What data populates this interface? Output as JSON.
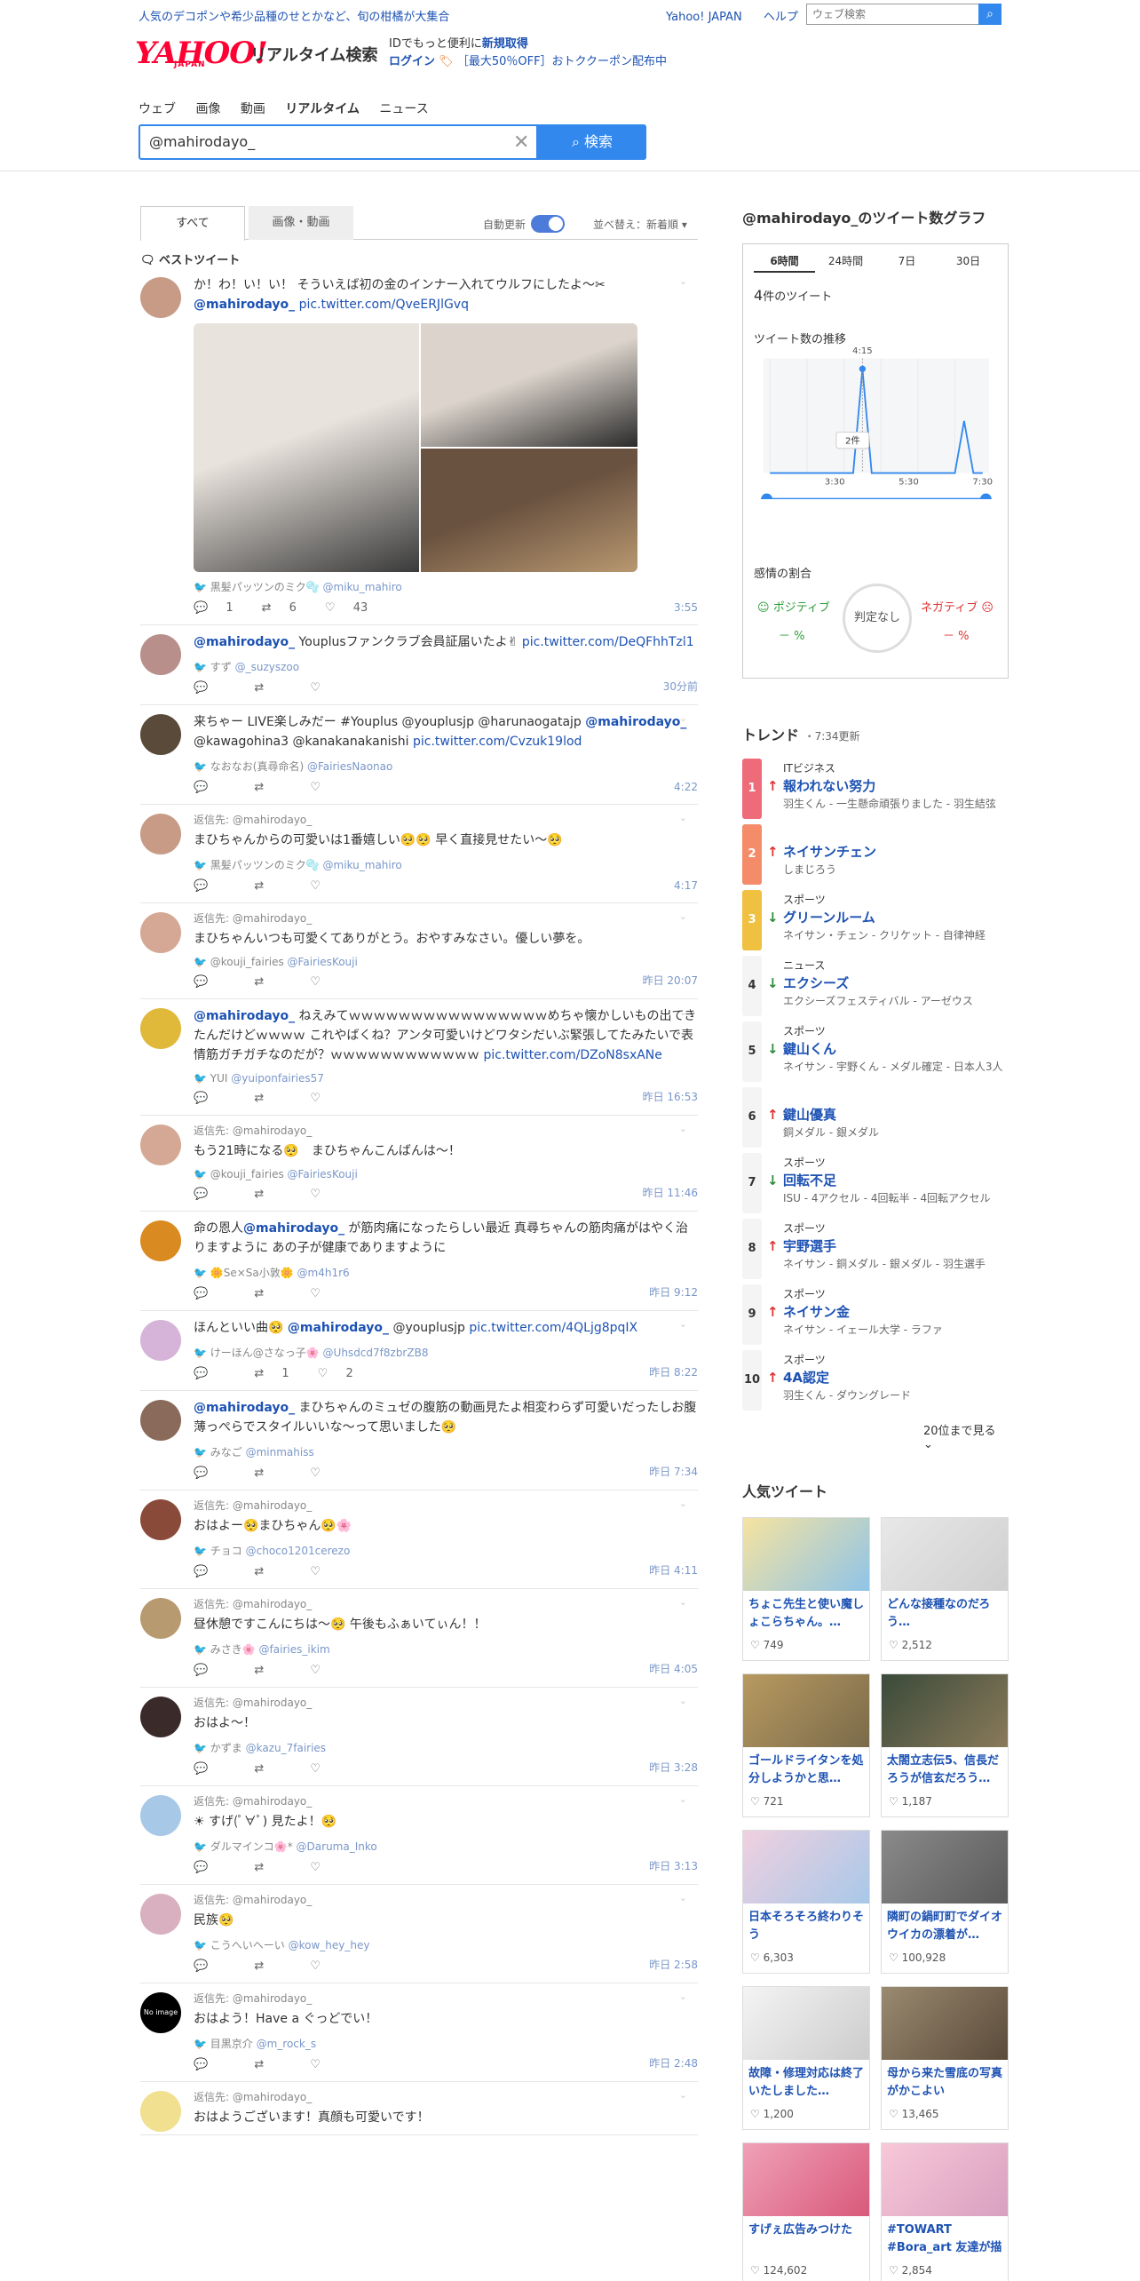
{
  "topbar": {
    "promo": "人気のデコポンや希少品種のせとかなど、旬の柑橘が大集合",
    "links": [
      "Yahoo! JAPAN",
      "ヘルプ"
    ],
    "search_placeholder": "ウェブ検索",
    "search_icon": "search-icon"
  },
  "logo": {
    "main": "YAHOO!",
    "sub": "JAPAN",
    "service": "リアルタイム検索"
  },
  "idbox": {
    "line1": "IDでもっと便利に",
    "line1_link": "新規取得",
    "line2_link": "ログイン",
    "line2_text": "［最大50％OFF］おトククーポン配布中"
  },
  "nav": [
    "ウェブ",
    "画像",
    "動画",
    "リアルタイム",
    "ニュース"
  ],
  "search": {
    "query": "@mahirodayo_",
    "button": "検索"
  },
  "left": {
    "tabs": [
      "すべて",
      "画像・動画"
    ],
    "auto_update": "自動更新",
    "sort": "並べ替え：新着順 ▾",
    "best": "ベストツイート"
  },
  "tweets": [
    {
      "avatar_color": "#c79b86",
      "reply": "",
      "pre": "か！わ！い！い！ そういえば初の金のインナー入れてウルフにしたよ〜✂︎ ",
      "mention": "@mahirodayo_",
      "post": " ",
      "link": "pic.twitter.com/QveERJlGvq",
      "user": "黒髪パッツンのミク🫧",
      "id": "@miku_mahiro",
      "reply_count": "1",
      "rt_count": "6",
      "like_count": "43",
      "time": "3:55"
    },
    {
      "avatar_color": "#b88f8a",
      "reply": "",
      "pre": "",
      "mention": "@mahirodayo_",
      "post": " Youplusファンクラブ会員証届いたよ✌ ",
      "link": "pic.twitter.com/DeQFhhTzl1",
      "user": "すず",
      "id": "@_suzyszoo",
      "reply_count": "",
      "rt_count": "",
      "like_count": "",
      "time": "30分前"
    },
    {
      "avatar_color": "#5a4a3a",
      "reply": "",
      "pre": "来ちゃー LIVE楽しみだー #Youplus @youplusjp @harunaogatajp ",
      "mention": "@mahirodayo_",
      "post": " @kawagohina3 @kanakanakanishi ",
      "link": "pic.twitter.com/Cvzuk19lod",
      "user": "なおなお(真尋命名)",
      "id": "@FairiesNaonao",
      "reply_count": "",
      "rt_count": "",
      "like_count": "",
      "time": "4:22"
    },
    {
      "avatar_color": "#c79b86",
      "reply": "返信先: @mahirodayo_",
      "pre": "まひちゃんからの可愛いは1番嬉しい🥺🥺 早く直接見せたい〜🥺",
      "mention": "",
      "post": "",
      "link": "",
      "user": "黒髪パッツンのミク🫧",
      "id": "@miku_mahiro",
      "reply_count": "",
      "rt_count": "",
      "like_count": "",
      "time": "4:17"
    },
    {
      "avatar_color": "#d4a894",
      "reply": "返信先: @mahirodayo_",
      "pre": "まひちゃんいつも可愛くてありがとう。おやすみなさい。優しい夢を。",
      "mention": "",
      "post": "",
      "link": "",
      "user": "@kouji_fairies",
      "id": "@FairiesKouji",
      "reply_count": "",
      "rt_count": "",
      "like_count": "",
      "time": "昨日 20:07"
    },
    {
      "avatar_color": "#e0b83a",
      "reply": "",
      "pre": "",
      "mention": "@mahirodayo_",
      "post": " ねえみてｗｗｗｗｗｗｗｗｗｗｗｗｗｗｗｗめちゃ懐かしいもの出てきたんだけどｗｗｗｗ これやばくね？アンタ可愛いけどワタシだいぶ緊張してたみたいで表情筋ガチガチなのだが？ｗｗｗｗｗｗｗｗｗｗｗｗ ",
      "link": "pic.twitter.com/DZoN8sxANe",
      "user": "YUI",
      "id": "@yuiponfairies57",
      "reply_count": "",
      "rt_count": "",
      "like_count": "",
      "time": "昨日 16:53"
    },
    {
      "avatar_color": "#d4a894",
      "reply": "返信先: @mahirodayo_",
      "pre": "もう21時になる🥺　まひちゃんこんばんは〜！",
      "mention": "",
      "post": "",
      "link": "",
      "user": "@kouji_fairies",
      "id": "@FairiesKouji",
      "reply_count": "",
      "rt_count": "",
      "like_count": "",
      "time": "昨日 11:46"
    },
    {
      "avatar_color": "#d98a20",
      "reply": "",
      "pre": "命の恩人",
      "mention": "@mahirodayo_",
      "post": " が筋肉痛になったらしい最近 真尋ちゃんの筋肉痛がはやく治りますように あの子が健康でありますように",
      "link": "",
      "user": "🌼Se×Sa小敦🌼",
      "id": "@m4h1r6",
      "reply_count": "",
      "rt_count": "",
      "like_count": "",
      "time": "昨日 9:12"
    },
    {
      "avatar_color": "#d6b3d8",
      "reply": "",
      "pre": "ほんといい曲🥺 ",
      "mention": "@mahirodayo_",
      "post": " @youplusjp ",
      "link": "pic.twitter.com/4QLjg8pqIX",
      "user": "けーほん@さなっ子🌸",
      "id": "@Uhsdcd7f8zbrZB8",
      "reply_count": "",
      "rt_count": "1",
      "like_count": "2",
      "time": "昨日 8:22"
    },
    {
      "avatar_color": "#8a6a5a",
      "reply": "",
      "pre": "",
      "mention": "@mahirodayo_",
      "post": " まひちゃんのミュゼの腹筋の動画見たよ相変わらず可愛いだったしお腹薄っぺらでスタイルいいな〜って思いました🥺",
      "link": "",
      "user": "みなご",
      "id": "@minmahiss",
      "reply_count": "",
      "rt_count": "",
      "like_count": "",
      "time": "昨日 7:34"
    },
    {
      "avatar_color": "#8a4a3a",
      "reply": "返信先: @mahirodayo_",
      "pre": "おはよー🥺まひちゃん🥺🌸",
      "mention": "",
      "post": "",
      "link": "",
      "user": "チョコ",
      "id": "@choco1201cerezo",
      "reply_count": "",
      "rt_count": "",
      "like_count": "",
      "time": "昨日 4:11"
    },
    {
      "avatar_color": "#b89a70",
      "reply": "返信先: @mahirodayo_",
      "pre": "昼休憩ですこんにちは〜🥺 午後もふぁいてぃん！！",
      "mention": "",
      "post": "",
      "link": "",
      "user": "みさき🌸",
      "id": "@fairies_ikim",
      "reply_count": "",
      "rt_count": "",
      "like_count": "",
      "time": "昨日 4:05"
    },
    {
      "avatar_color": "#3a2a2a",
      "reply": "返信先: @mahirodayo_",
      "pre": "おはよ〜！",
      "mention": "",
      "post": "",
      "link": "",
      "user": "かずま",
      "id": "@kazu_7fairies",
      "reply_count": "",
      "rt_count": "",
      "like_count": "",
      "time": "昨日 3:28"
    },
    {
      "avatar_color": "#a8c8e8",
      "reply": "返信先: @mahirodayo_",
      "pre": "☀ すげ(ﾟ∀ﾟ) 見たよ！🥺",
      "mention": "",
      "post": "",
      "link": "",
      "user": "ダルマインコ🌸*",
      "id": "@Daruma_Inko",
      "reply_count": "",
      "rt_count": "",
      "like_count": "",
      "time": "昨日 3:13"
    },
    {
      "avatar_color": "#d8b0c0",
      "reply": "返信先: @mahirodayo_",
      "pre": "民族🥺",
      "mention": "",
      "post": "",
      "link": "",
      "user": "こうへいヘーい",
      "id": "@kow_hey_hey",
      "reply_count": "",
      "rt_count": "",
      "like_count": "",
      "time": "昨日 2:58"
    },
    {
      "avatar_color": "#000000",
      "avatar_text": "No image",
      "reply": "返信先: @mahirodayo_",
      "pre": "おはよう！Have a ぐっどでい！",
      "mention": "",
      "post": "",
      "link": "",
      "user": "目黒京介",
      "id": "@m_rock_s",
      "reply_count": "",
      "rt_count": "",
      "like_count": "",
      "time": "昨日 2:48"
    },
    {
      "avatar_color": "#f0e090",
      "reply": "返信先: @mahirodayo_",
      "pre": "おはようございます！真顔も可愛いです！",
      "mention": "",
      "post": "",
      "link": "",
      "user": "",
      "id": "",
      "reply_count": "",
      "rt_count": "",
      "like_count": "",
      "time": ""
    }
  ],
  "graph": {
    "title": "@mahirodayo_のツイート数グラフ",
    "tabs": [
      "6時間",
      "24時間",
      "7日",
      "30日"
    ],
    "count": "4",
    "count_unit": "件のツイート",
    "trend_label": "ツイート数の推移",
    "peak_label": "4:15",
    "tooltip": "2件",
    "emotion_label": "感情の割合",
    "positive": "ポジティブ",
    "negative": "ネガティブ",
    "pos_value": "－ %",
    "neg_value": "－ %",
    "judge": "判定なし"
  },
  "chart_data": {
    "type": "line",
    "x": [
      "1:45",
      "2:00",
      "2:15",
      "2:30",
      "2:45",
      "3:00",
      "3:15",
      "3:30",
      "3:45",
      "4:00",
      "4:15",
      "4:30",
      "4:45",
      "5:00",
      "5:15",
      "5:30",
      "5:45",
      "6:00",
      "6:15",
      "6:30",
      "6:45",
      "7:00",
      "7:15",
      "7:30"
    ],
    "values": [
      0,
      0,
      0,
      0,
      0,
      0,
      0,
      0,
      0,
      0,
      2,
      0,
      0,
      0,
      0,
      0,
      0,
      0,
      0,
      0,
      0,
      1,
      0,
      0
    ],
    "xticks": [
      "3:30",
      "5:30",
      "7:30"
    ],
    "grid": true,
    "color": "#3388ee"
  },
  "trends": {
    "title": "トレンド",
    "updated": "・7:34更新",
    "items": [
      {
        "rank": "1",
        "color": "#ee6b7a",
        "cat": "ITビジネス",
        "dir": "up",
        "name": "報われない努力",
        "sub": "羽生くん - 一生懸命頑張りました - 羽生結弦"
      },
      {
        "rank": "2",
        "color": "#f48c6a",
        "cat": "",
        "dir": "up",
        "name": "ネイサンチェン",
        "sub": "しまじろう"
      },
      {
        "rank": "3",
        "color": "#f0c040",
        "cat": "スポーツ",
        "dir": "down",
        "name": "グリーンルーム",
        "sub": "ネイサン・チェン - クリケット - 自律神経"
      },
      {
        "rank": "4",
        "color": "#f4f4f4",
        "cat": "ニュース",
        "dir": "down",
        "name": "エクシーズ",
        "sub": "エクシーズフェスティバル - アーゼウス"
      },
      {
        "rank": "5",
        "color": "#f4f4f4",
        "cat": "スポーツ",
        "dir": "down",
        "name": "鍵山くん",
        "sub": "ネイサン - 宇野くん - メダル確定 - 日本人3人"
      },
      {
        "rank": "6",
        "color": "#f4f4f4",
        "cat": "",
        "dir": "up",
        "name": "鍵山優真",
        "sub": "銅メダル - 銀メダル"
      },
      {
        "rank": "7",
        "color": "#f4f4f4",
        "cat": "スポーツ",
        "dir": "down",
        "name": "回転不足",
        "sub": "ISU - 4アクセル - 4回転半 - 4回転アクセル"
      },
      {
        "rank": "8",
        "color": "#f4f4f4",
        "cat": "スポーツ",
        "dir": "up",
        "name": "宇野選手",
        "sub": "ネイサン - 銅メダル - 銀メダル - 羽生選手"
      },
      {
        "rank": "9",
        "color": "#f4f4f4",
        "cat": "スポーツ",
        "dir": "up",
        "name": "ネイサン金",
        "sub": "ネイサン - イェール大学 - ラファ"
      },
      {
        "rank": "10",
        "color": "#f4f4f4",
        "cat": "スポーツ",
        "dir": "up",
        "name": "4A認定",
        "sub": "羽生くん - ダウングレード"
      }
    ],
    "more": "20位まで見る ⌄"
  },
  "popular": {
    "title": "人気ツイート",
    "items": [
      {
        "title": "ちょこ先生と使い魔しょこらちゃん。…",
        "likes": "749",
        "c1": "#f6e3a0",
        "c2": "#8fc4e8"
      },
      {
        "title": "どんな接種なのだろう…",
        "likes": "2,512",
        "c1": "#e8e8e8",
        "c2": "#cfcfcf"
      },
      {
        "title": "ゴールドライタンを処分しようかと思…",
        "likes": "721",
        "c1": "#b89a60",
        "c2": "#7a6a4a"
      },
      {
        "title": "太閤立志伝5、信長だろうが信玄だろう…",
        "likes": "1,187",
        "c1": "#3a4a3a",
        "c2": "#8a7a5a"
      },
      {
        "title": "日本そろそろ終わりそう",
        "likes": "6,303",
        "c1": "#f0d0e0",
        "c2": "#a8c8e8"
      },
      {
        "title": "隣町の鍋町町でダイオウイカの漂着が…",
        "likes": "100,928",
        "c1": "#8a8a8a",
        "c2": "#5a5a5a"
      },
      {
        "title": "故障・修理対応は終了いたしました…",
        "likes": "1,200",
        "c1": "#f4f4f4",
        "c2": "#cccccc"
      },
      {
        "title": "母から来た雪底の写真がかこよい",
        "likes": "13,465",
        "c1": "#9a8a70",
        "c2": "#5a4a3a"
      },
      {
        "title": "すげぇ広告みつけた",
        "likes": "124,602",
        "c1": "#f0a0b8",
        "c2": "#d85a7a"
      },
      {
        "title": "#TOWART #Bora_art 友達が描いてくれ…",
        "likes": "2,854",
        "c1": "#f8c8d8",
        "c2": "#d8a0c0"
      }
    ]
  }
}
